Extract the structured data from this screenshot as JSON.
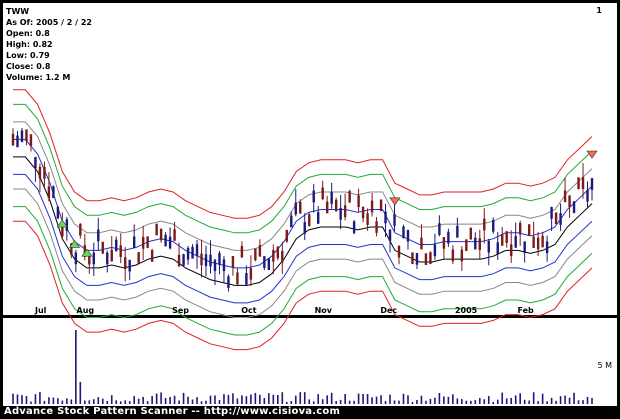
{
  "app": {
    "ticker": "TWW",
    "page_number": "1",
    "footer": "Advance Stock Pattern Scanner -- http://www.cisiova.com"
  },
  "info": {
    "as_of_label": "As Of:",
    "as_of": "2005 / 2 / 22",
    "open_label": "Open:",
    "open": "0.8",
    "high_label": "High:",
    "high": "0.82",
    "low_label": "Low:",
    "low": "0.79",
    "close_label": "Close:",
    "close": "0.8",
    "volume_label": "Volume:",
    "volume": "1.2 M"
  },
  "volume_scale_label": "5 M",
  "colors": {
    "red_band": "#dd2222",
    "green_band": "#22aa33",
    "gray_band": "#888888",
    "blue_band": "#2233cc",
    "center": "#000000",
    "candle_down": "#7a1a1a",
    "candle_up": "#1a1a7a",
    "volume_bar": "#1a1a7a"
  },
  "chart_data": {
    "type": "line",
    "x_ticks": [
      "Jul",
      "Aug",
      "Sep",
      "Oct",
      "Nov",
      "Dec",
      "2005",
      "Feb"
    ],
    "x_positions": [
      0.06,
      0.135,
      0.295,
      0.41,
      0.535,
      0.645,
      0.775,
      0.875
    ],
    "center_line": [
      0.9,
      0.9,
      0.85,
      0.75,
      0.62,
      0.55,
      0.52,
      0.52,
      0.53,
      0.52,
      0.53,
      0.55,
      0.56,
      0.55,
      0.52,
      0.5,
      0.48,
      0.47,
      0.46,
      0.46,
      0.47,
      0.5,
      0.55,
      0.62,
      0.65,
      0.66,
      0.66,
      0.66,
      0.65,
      0.66,
      0.66,
      0.58,
      0.56,
      0.54,
      0.54,
      0.55,
      0.55,
      0.55,
      0.55,
      0.56,
      0.58,
      0.58,
      0.57,
      0.58,
      0.6,
      0.66,
      0.7,
      0.74
    ],
    "band_offsets": [
      0.17,
      0.12,
      0.06,
      0.0,
      -0.06,
      -0.12,
      -0.17,
      -0.23,
      -0.28
    ],
    "markers": [
      {
        "type": "buy",
        "index": 4
      },
      {
        "type": "buy",
        "index": 5
      },
      {
        "type": "buy",
        "index": 6
      },
      {
        "type": "sell",
        "index": 31
      },
      {
        "type": "sell",
        "index": 47
      }
    ]
  }
}
